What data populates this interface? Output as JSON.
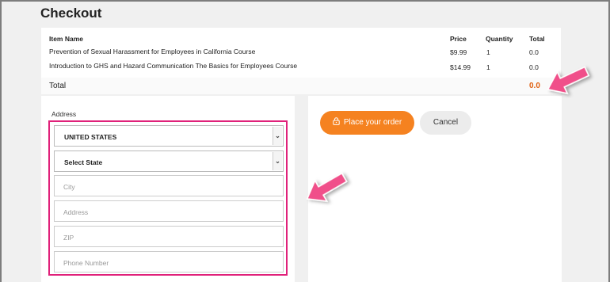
{
  "page": {
    "title": "Checkout"
  },
  "order": {
    "headers": {
      "item": "Item Name",
      "price": "Price",
      "quantity": "Quantity",
      "total": "Total"
    },
    "items": [
      {
        "name": "Prevention of Sexual Harassment for Employees in California Course",
        "price": "$9.99",
        "quantity": "1",
        "total": "0.0"
      },
      {
        "name": "Introduction to GHS and Hazard Communication The Basics for Employees Course",
        "price": "$14.99",
        "quantity": "1",
        "total": "0.0"
      }
    ],
    "total_label": "Total",
    "total_value": "0.0"
  },
  "address": {
    "label": "Address",
    "country": "UNITED STATES",
    "state": "Select State",
    "city_placeholder": "City",
    "address_placeholder": "Address",
    "zip_placeholder": "ZIP",
    "phone_placeholder": "Phone Number"
  },
  "actions": {
    "place_order": "Place your order",
    "cancel": "Cancel"
  },
  "colors": {
    "accent": "#f58220",
    "highlight": "#e0217a",
    "total": "#e06010"
  },
  "icons": {
    "lock": "lock-icon",
    "caret": "chevron-down-icon",
    "arrow": "pink-arrow-icon"
  }
}
